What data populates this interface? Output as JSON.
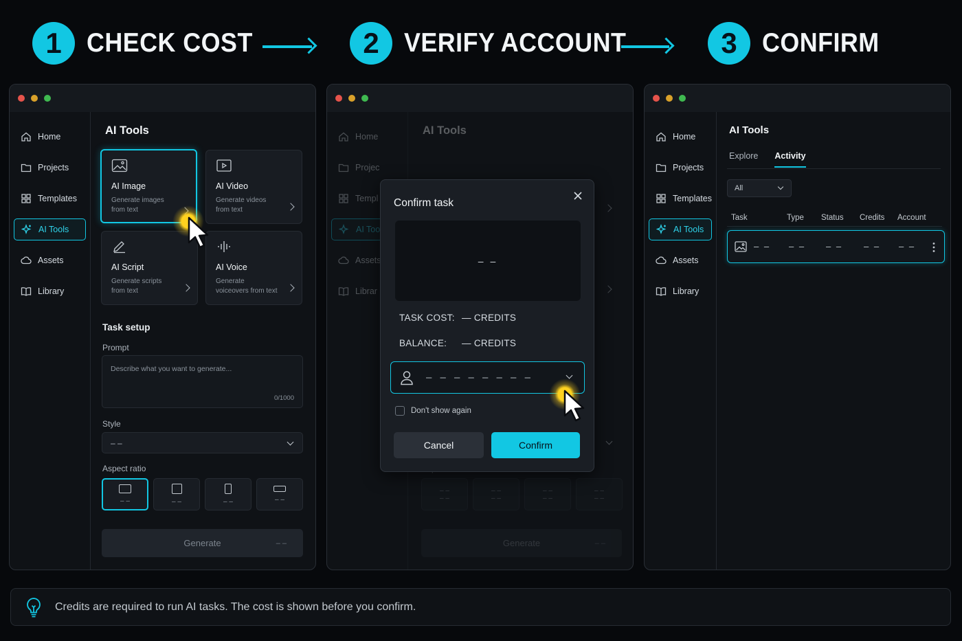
{
  "steps": [
    {
      "num": "1",
      "title": "CHECK COST"
    },
    {
      "num": "2",
      "title": "VERIFY ACCOUNT"
    },
    {
      "num": "3",
      "title": "CONFIRM"
    }
  ],
  "sidebar": {
    "items": [
      {
        "label": "Home",
        "icon": "home-icon"
      },
      {
        "label": "Projects",
        "icon": "folder-icon"
      },
      {
        "label": "Templates",
        "icon": "templates-icon"
      },
      {
        "label": "AI Tools",
        "icon": "sparkle-icon",
        "active": true
      },
      {
        "label": "Assets",
        "icon": "cloud-icon"
      },
      {
        "label": "Library",
        "icon": "book-icon"
      }
    ],
    "dim_items": [
      "Home",
      "Projec",
      "Templ",
      "AI Too",
      "Assets",
      "Librar"
    ]
  },
  "page_title": "AI Tools",
  "tools": [
    {
      "name": "AI Image",
      "desc": "Generate images from text"
    },
    {
      "name": "AI Video",
      "desc": "Generate videos from text"
    },
    {
      "name": "AI Script",
      "desc": "Generate scripts from text"
    },
    {
      "name": "AI Voice",
      "desc": "Generate voiceovers from text"
    }
  ],
  "task_setup": {
    "title": "Task setup",
    "prompt_label": "Prompt",
    "prompt_placeholder": "Describe what you want to generate...",
    "char_count": "0/1000",
    "style_label": "Style",
    "style_value": "– –",
    "aspect_label": "Aspect ratio",
    "ratio_value": "– –",
    "generate_label": "Generate",
    "generate_cost": "– –"
  },
  "dialog": {
    "title": "Confirm task",
    "preview": "– –",
    "task_cost_label": "TASK COST:",
    "task_cost_value": "—  CREDITS",
    "balance_label": "BALANCE:",
    "balance_value": "—  CREDITS",
    "account_value": "– – – – – – – –",
    "dont_show": "Don't show again",
    "cancel": "Cancel",
    "confirm": "Confirm"
  },
  "activity": {
    "tabs": [
      "Explore",
      "Activity"
    ],
    "filter": "All",
    "columns": [
      "Task",
      "Type",
      "Status",
      "Credits",
      "Account"
    ],
    "row": [
      "– –",
      "– –",
      "– –",
      "– –",
      "– –"
    ]
  },
  "footer_text": "Credits are required to run AI tasks. The cost is shown before you confirm.",
  "colors": {
    "accent": "#12c7e3",
    "highlight": "#ffd21f"
  }
}
